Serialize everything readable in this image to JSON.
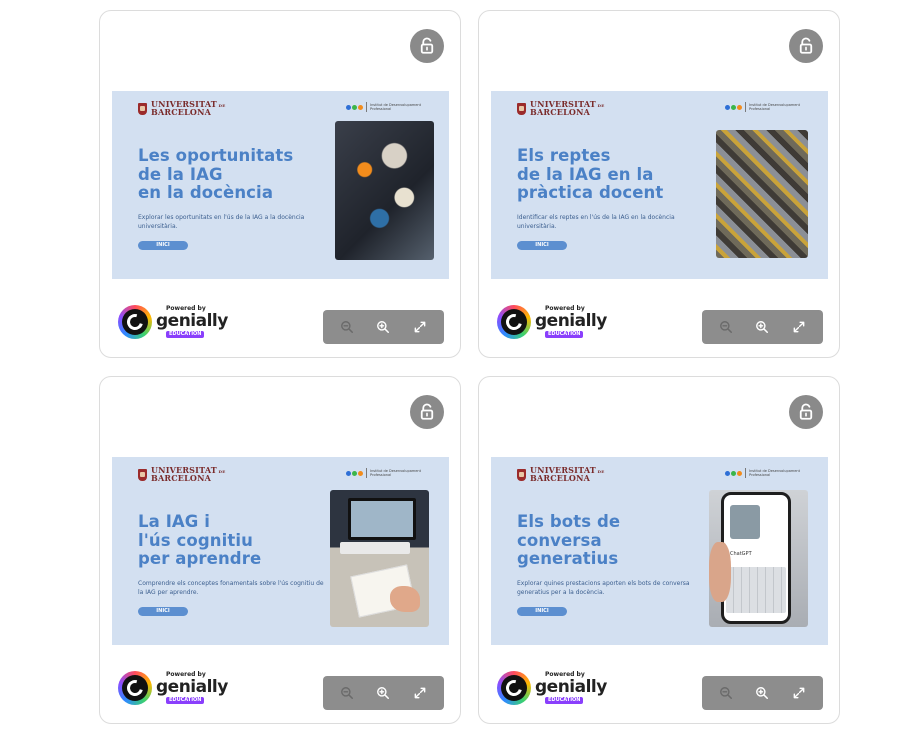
{
  "cards": [
    {
      "slide": {
        "institution": [
          "UNIVERSITAT",
          "DE",
          "BARCELONA"
        ],
        "idp_text": [
          "Institut de Desenvolupament",
          "Professional"
        ],
        "title_lines": [
          "Les oportunitats",
          "de la IAG",
          "en la docència"
        ],
        "subtitle": "Explorar les oportunitats en l'ús de la IAG a la docència universitària.",
        "button_label": "INICI",
        "image": "abstract-shapes"
      },
      "powered_by": "Powered by",
      "brand": "genially",
      "edu_badge": "EDUCATION"
    },
    {
      "slide": {
        "institution": [
          "UNIVERSITAT",
          "DE",
          "BARCELONA"
        ],
        "idp_text": [
          "Institut de Desenvolupament",
          "Professional"
        ],
        "title_lines": [
          "Els reptes",
          "de la IAG en la",
          "pràctica docent"
        ],
        "subtitle": "Identificar els reptes en l'ús de la IAG en la docència universitària.",
        "button_label": "INICI",
        "image": "puzzle-pieces"
      },
      "powered_by": "Powered by",
      "brand": "genially",
      "edu_badge": "EDUCATION"
    },
    {
      "slide": {
        "institution": [
          "UNIVERSITAT",
          "DE",
          "BARCELONA"
        ],
        "idp_text": [
          "Institut de Desenvolupament",
          "Professional"
        ],
        "title_lines": [
          "La IAG i",
          "l'ús cognitiu",
          "per aprendre"
        ],
        "subtitle": "Comprendre els conceptes fonamentals sobre l'ús cognitiu de la IAG per aprendre.",
        "button_label": "INICI",
        "image": "desk-laptop"
      },
      "powered_by": "Powered by",
      "brand": "genially",
      "edu_badge": "EDUCATION"
    },
    {
      "slide": {
        "institution": [
          "UNIVERSITAT",
          "DE",
          "BARCELONA"
        ],
        "idp_text": [
          "Institut de Desenvolupament",
          "Professional"
        ],
        "title_lines": [
          "Els bots de",
          "conversa",
          "generatius"
        ],
        "subtitle": "Explorar quines prestacions aporten els bots de conversa generatius per a la docència.",
        "button_label": "INICI",
        "image": "phone-chat",
        "phone_text": [
          "ChatGPT"
        ]
      },
      "powered_by": "Powered by",
      "brand": "genially",
      "edu_badge": "EDUCATION"
    }
  ],
  "colors": {
    "slide_bg": "#d3e0f1",
    "title": "#4b81c6",
    "toolbar": "#8d8d8d",
    "unlock_button": "#8a8a8a",
    "edu_badge": "#8a3ffc"
  },
  "icons": {
    "unlock": "unlock-icon",
    "zoom_out": "zoom-out-icon",
    "zoom_in": "zoom-in-icon",
    "fullscreen": "fullscreen-icon"
  }
}
